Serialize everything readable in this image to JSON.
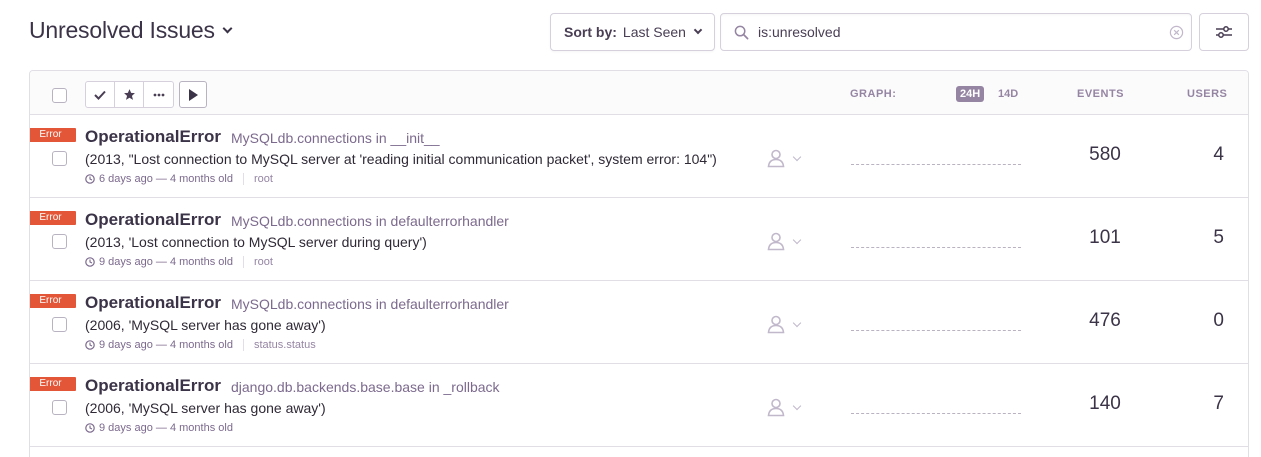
{
  "page": {
    "title": "Unresolved Issues"
  },
  "sort": {
    "label": "Sort by:",
    "value": "Last Seen"
  },
  "search": {
    "query": "is:unresolved",
    "icon": "search-icon"
  },
  "header": {
    "graph_label": "GRAPH:",
    "period_24h": "24H",
    "period_14d": "14D",
    "events_label": "EVENTS",
    "users_label": "USERS",
    "actions": [
      "check-icon",
      "star-icon",
      "ellipsis-icon",
      "play-icon"
    ]
  },
  "colors": {
    "error_badge": "#e45638",
    "text_primary": "#3b3347",
    "text_muted": "#7c6a8e",
    "border": "#e2dee6"
  },
  "issues": [
    {
      "level": "Error",
      "title": "OperationalError",
      "culprit": "MySQLdb.connections in __init__",
      "message": "(2013, \"Lost connection to MySQL server at 'reading initial communication packet', system error: 104\")",
      "last_seen": "6 days ago",
      "age": "4 months old",
      "project": "root",
      "events": "580",
      "users": "4"
    },
    {
      "level": "Error",
      "title": "OperationalError",
      "culprit": "MySQLdb.connections in defaulterrorhandler",
      "message": "(2013, 'Lost connection to MySQL server during query')",
      "last_seen": "9 days ago",
      "age": "4 months old",
      "project": "root",
      "events": "101",
      "users": "5"
    },
    {
      "level": "Error",
      "title": "OperationalError",
      "culprit": "MySQLdb.connections in defaulterrorhandler",
      "message": "(2006, 'MySQL server has gone away')",
      "last_seen": "9 days ago",
      "age": "4 months old",
      "project": "status.status",
      "events": "476",
      "users": "0"
    },
    {
      "level": "Error",
      "title": "OperationalError",
      "culprit": "django.db.backends.base.base in _rollback",
      "message": "(2006, 'MySQL server has gone away')",
      "last_seen": "9 days ago",
      "age": "4 months old",
      "project": "",
      "events": "140",
      "users": "7"
    }
  ]
}
